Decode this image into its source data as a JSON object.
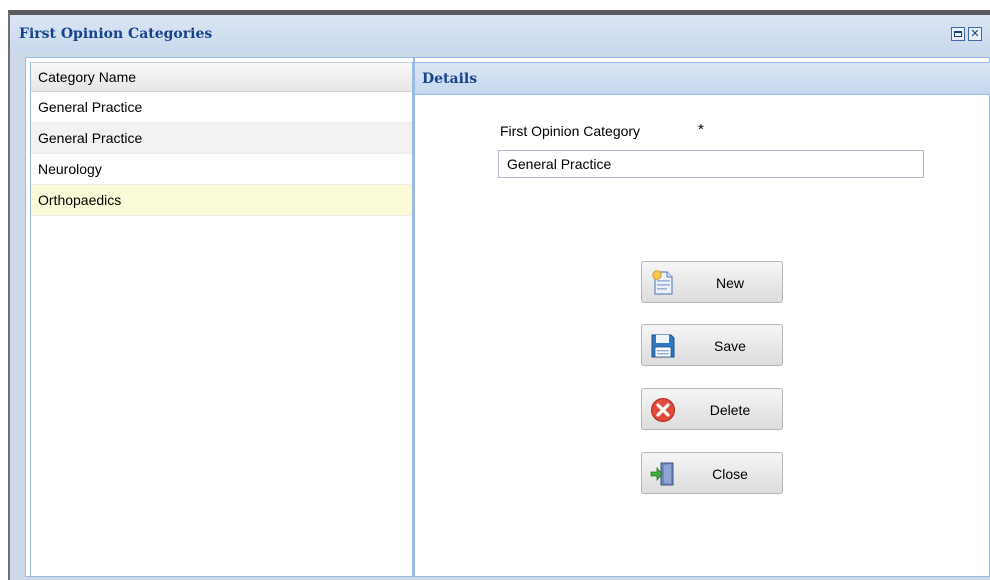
{
  "window": {
    "title": "First Opinion Categories"
  },
  "grid": {
    "header": "Category Name",
    "rows": [
      "General Practice",
      "General Practice",
      "Neurology",
      "Orthopaedics"
    ]
  },
  "details": {
    "title": "Details",
    "field_label": "First Opinion Category",
    "required_mark": "*",
    "field_value": "General Practice"
  },
  "buttons": {
    "new": "New",
    "save": "Save",
    "delete": "Delete",
    "close": "Close"
  },
  "icons": {
    "titlebar": [
      "maximize-icon",
      "close-icon"
    ],
    "buttons": [
      "new-document-icon",
      "save-disk-icon",
      "delete-icon",
      "exit-door-icon"
    ]
  },
  "colors": {
    "title_text": "#15428b",
    "panel_border": "#99bbe8",
    "selected_row": "#fbfbd9"
  }
}
